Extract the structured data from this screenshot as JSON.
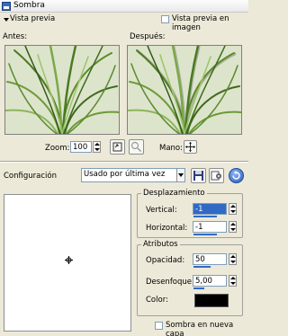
{
  "window": {
    "title": "Sombra"
  },
  "preview": {
    "toggle_label": "Vista previa",
    "live_label": "Vista previa en imagen",
    "before_label": "Antes:",
    "after_label": "Después:"
  },
  "zoom": {
    "label": "Zoom:",
    "value": "100",
    "hand_label": "Mano:"
  },
  "config": {
    "label": "Configuración",
    "selected": "Usado por última vez"
  },
  "offset": {
    "title": "Desplazamiento",
    "vertical_label": "Vertical:",
    "vertical_value": "-1",
    "horizontal_label": "Horizontal:",
    "horizontal_value": "-1"
  },
  "attributes": {
    "title": "Atributos",
    "opacity_label": "Opacidad:",
    "opacity_value": "50",
    "blur_label": "Desenfoque:",
    "blur_value": "5,00",
    "color_label": "Color:",
    "color": "#000000"
  },
  "new_layer": {
    "label": "Sombra en nueva capa"
  },
  "colors": {
    "accent": "#316ac5",
    "bg": "#ece9d8"
  }
}
